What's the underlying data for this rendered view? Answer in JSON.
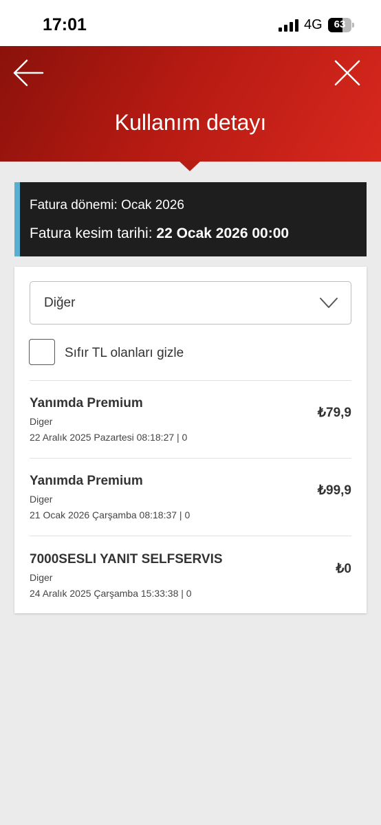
{
  "status_bar": {
    "time": "17:01",
    "network": "4G",
    "battery": "63",
    "battery_level": 0.63
  },
  "header": {
    "title": "Kullanım detayı",
    "back_icon": "arrow-left-icon",
    "close_icon": "close-icon",
    "color_start": "#8a120b",
    "color_end": "#d8281e"
  },
  "bill_info": {
    "period_label": "Fatura dönemi: Ocak 2026",
    "cut_label": "Fatura kesim tarihi: ",
    "cut_value": "22 Ocak 2026 00:00",
    "accent_color": "#5aaed0"
  },
  "filter": {
    "selected": "Diğer",
    "hide_zero_label": "Sıfır TL olanları gizle",
    "hide_zero_checked": false
  },
  "items": [
    {
      "title": "Yanımda Premium",
      "category": "Diger",
      "date": "22 Aralık 2025 Pazartesi 08:18:27 | 0",
      "price": "₺79,9"
    },
    {
      "title": "Yanımda Premium",
      "category": "Diger",
      "date": "21 Ocak 2026 Çarşamba 08:18:37 | 0",
      "price": "₺99,9"
    },
    {
      "title": "7000SESLI YANIT SELFSERVIS",
      "category": "Diger",
      "date": "24 Aralık 2025 Çarşamba 15:33:38 | 0",
      "price": "₺0"
    }
  ]
}
